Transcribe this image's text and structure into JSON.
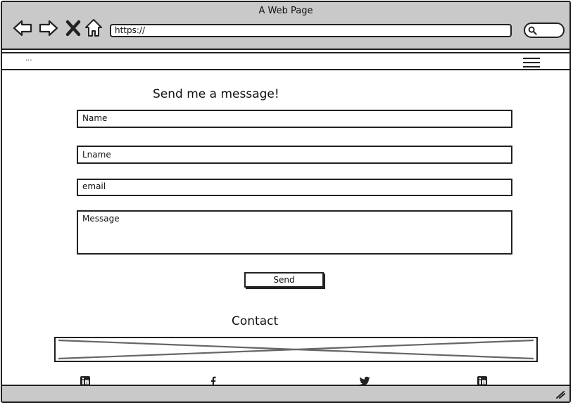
{
  "window": {
    "title": "A Web Page"
  },
  "browser": {
    "url": "https://",
    "icons": [
      "back-arrow-icon",
      "forward-arrow-icon",
      "close-icon",
      "home-icon",
      "search-icon"
    ]
  },
  "navbar": {
    "menu_text": "..."
  },
  "form": {
    "title": "Send me a message!",
    "name_placeholder": "Name",
    "lname_placeholder": "Lname",
    "email_placeholder": "email",
    "message_placeholder": "Message",
    "send_label": "Send"
  },
  "contact": {
    "title": "Contact",
    "social_icons": [
      "linkedin-icon",
      "facebook-icon",
      "twitter-icon",
      "linkedin-icon"
    ]
  },
  "colors": {
    "chrome": "#c9c9c9",
    "stroke": "#222222",
    "background": "#ffffff"
  }
}
